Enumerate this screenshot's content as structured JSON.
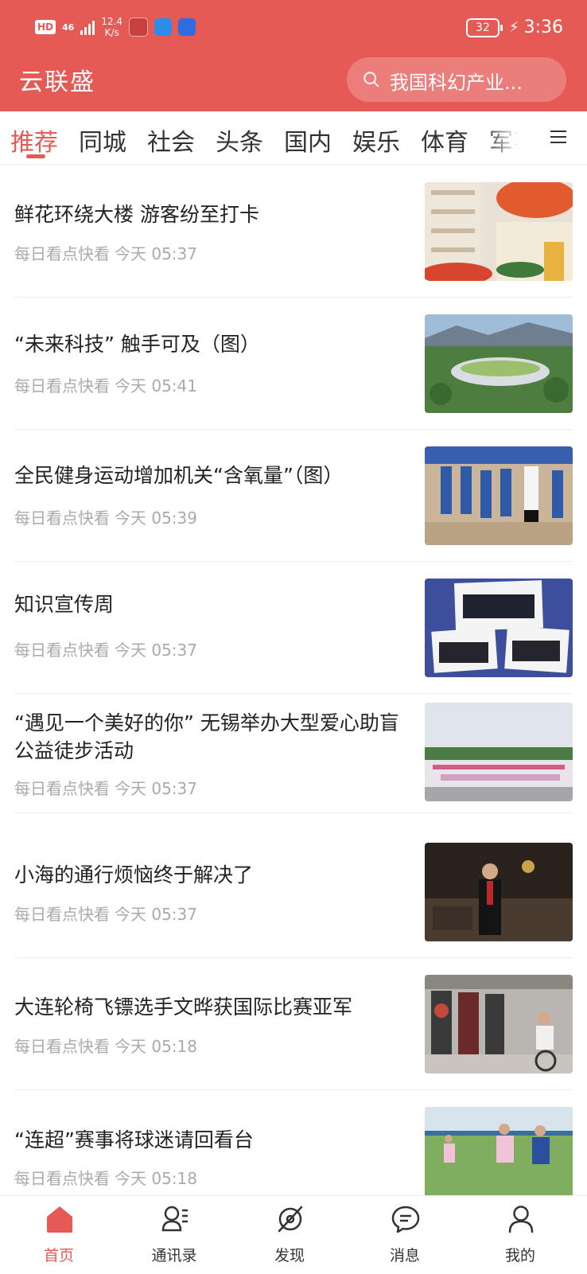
{
  "status_bar": {
    "hd": "HD",
    "network": "46",
    "speed_value": "12.4",
    "speed_unit": "K/s",
    "battery": "32",
    "time": "3:36"
  },
  "header": {
    "app_title": "云联盛",
    "search_placeholder": "我国科幻产业..."
  },
  "tabs": [
    {
      "label": "推荐",
      "active": true
    },
    {
      "label": "同城"
    },
    {
      "label": "社会"
    },
    {
      "label": "头条"
    },
    {
      "label": "国内"
    },
    {
      "label": "娱乐"
    },
    {
      "label": "体育"
    },
    {
      "label": "军事"
    }
  ],
  "news": [
    {
      "title": "鲜花环绕大楼 游客纷至打卡",
      "source": "每日看点快看",
      "time": "今天 05:37"
    },
    {
      "title": "“未来科技” 触手可及（图）",
      "source": "每日看点快看",
      "time": "今天 05:41"
    },
    {
      "title": "全民健身运动增加机关“含氧量”（图）",
      "source": "每日看点快看",
      "time": "今天 05:39"
    },
    {
      "title": "知识宣传周",
      "source": "每日看点快看",
      "time": "今天 05:37"
    },
    {
      "title": "“遇见一个美好的你” 无锡举办大型爱心助盲公益徒步活动",
      "source": "每日看点快看",
      "time": "今天 05:37"
    },
    {
      "title": "小海的通行烦恼终于解决了",
      "source": "每日看点快看",
      "time": "今天 05:37"
    },
    {
      "title": "大连轮椅飞镖选手文晔获国际比赛亚军",
      "source": "每日看点快看",
      "time": "今天 05:18"
    },
    {
      "title": "“连超”赛事将球迷请回看台",
      "source": "每日看点快看",
      "time": "今天 05:18"
    }
  ],
  "bottom_nav": [
    {
      "label": "首页",
      "icon": "home-icon",
      "active": true
    },
    {
      "label": "通讯录",
      "icon": "contacts-icon"
    },
    {
      "label": "发现",
      "icon": "discover-icon"
    },
    {
      "label": "消息",
      "icon": "message-icon"
    },
    {
      "label": "我的",
      "icon": "profile-icon"
    }
  ],
  "colors": {
    "brand": "#E65A56",
    "meta_text": "#aaaaaa"
  }
}
